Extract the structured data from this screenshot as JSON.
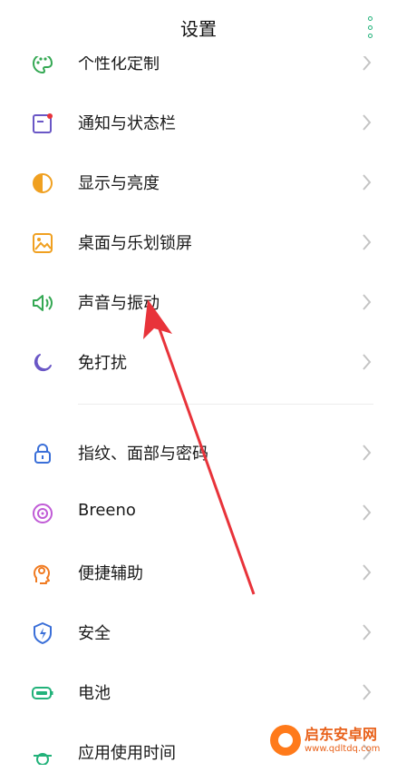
{
  "header": {
    "title": "设置"
  },
  "items": [
    {
      "label": "个性化定制",
      "icon": "palette-icon"
    },
    {
      "label": "通知与状态栏",
      "icon": "notification-icon"
    },
    {
      "label": "显示与亮度",
      "icon": "brightness-icon"
    },
    {
      "label": "桌面与乐划锁屏",
      "icon": "wallpaper-icon"
    },
    {
      "label": "声音与振动",
      "icon": "speaker-icon"
    },
    {
      "label": "免打扰",
      "icon": "moon-icon"
    },
    {
      "label": "指纹、面部与密码",
      "icon": "lock-icon"
    },
    {
      "label": "Breeno",
      "icon": "breeno-icon"
    },
    {
      "label": "便捷辅助",
      "icon": "assist-icon"
    },
    {
      "label": "安全",
      "icon": "shield-icon"
    },
    {
      "label": "电池",
      "icon": "battery-icon"
    },
    {
      "label": "应用使用时间",
      "icon": "timer-icon"
    }
  ],
  "watermark": {
    "name": "启东安卓网",
    "url": "www.qdltdq.com"
  },
  "colors": {
    "accent": "#22b27a",
    "arrow": "#e8333a"
  }
}
